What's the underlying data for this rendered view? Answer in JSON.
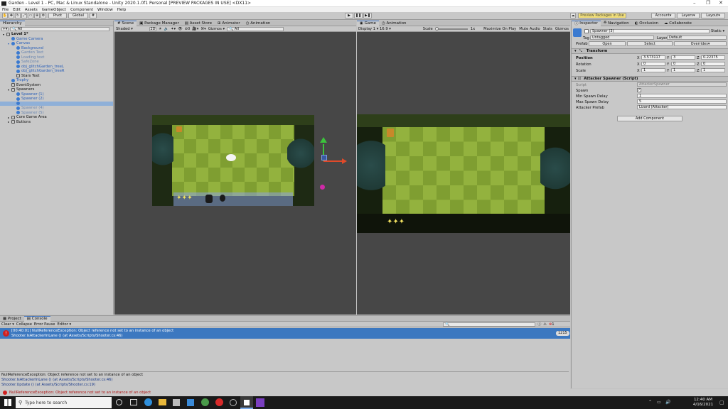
{
  "window": {
    "title": "Garden - Level 1 - PC, Mac & Linux Standalone - Unity 2020.1.0f1 Personal [PREVIEW PACKAGES IN USE] <DX11>"
  },
  "menu": [
    "File",
    "Edit",
    "Assets",
    "GameObject",
    "Component",
    "Window",
    "Help"
  ],
  "toolbar": {
    "pivot": "Pivot",
    "global": "Global",
    "preview_packages": "Preview Packages in Use",
    "account": "Account",
    "layers": "Layers",
    "layout": "Layout"
  },
  "hierarchy": {
    "tab": "Hierarchy",
    "search_placeholder": "All",
    "items": [
      {
        "label": "Level 1*",
        "indent": 0,
        "style": "bold"
      },
      {
        "label": "Game Camera",
        "indent": 1,
        "style": "blue"
      },
      {
        "label": "Canvas",
        "indent": 1,
        "style": "blue"
      },
      {
        "label": "Background",
        "indent": 2,
        "style": "blue"
      },
      {
        "label": "Garden Text",
        "indent": 2,
        "style": "grey"
      },
      {
        "label": "Loading text",
        "indent": 2,
        "style": "grey"
      },
      {
        "label": "SafeZone",
        "indent": 2,
        "style": "grey"
      },
      {
        "label": "obj_glitchGarden_treeL",
        "indent": 2,
        "style": "blue"
      },
      {
        "label": "obj_glitchGarden_treeR",
        "indent": 2,
        "style": "blue"
      },
      {
        "label": "Stars Text",
        "indent": 2,
        "style": "plain"
      },
      {
        "label": "Trophy",
        "indent": 1,
        "style": "blue"
      },
      {
        "label": "EventSystem",
        "indent": 1,
        "style": "plain"
      },
      {
        "label": "Spawners",
        "indent": 1,
        "style": "plain"
      },
      {
        "label": "Spawner (1)",
        "indent": 2,
        "style": "blue"
      },
      {
        "label": "Spawner (2)",
        "indent": 2,
        "style": "blue"
      },
      {
        "label": "",
        "indent": 2,
        "style": "sel"
      },
      {
        "label": "Spawner (4)",
        "indent": 2,
        "style": "grey"
      },
      {
        "label": "Spawner (5)",
        "indent": 2,
        "style": "grey"
      },
      {
        "label": "Core Game Area",
        "indent": 1,
        "style": "plain"
      },
      {
        "label": "Buttons",
        "indent": 1,
        "style": "plain"
      }
    ]
  },
  "scene": {
    "tabs": [
      "Scene",
      "Package Manager",
      "Asset Store",
      "Animator",
      "Animation"
    ],
    "shading": "Shaded",
    "mode_2d": "2D",
    "gizmos": "Gizmos",
    "search_placeholder": "All",
    "hidden_count": "0"
  },
  "game": {
    "tabs": [
      "Game",
      "Animation"
    ],
    "display": "Display 1",
    "aspect": "16:9",
    "scale_label": "Scale",
    "scale_value": "1x",
    "maximize": "Maximize On Play",
    "mute": "Mute Audio",
    "stats": "Stats",
    "gizmos": "Gizmos"
  },
  "inspector": {
    "tabs": [
      "Inspector",
      "Navigation",
      "Occlusion",
      "Collaborate"
    ],
    "object_name": "Spawner (3)",
    "static": "Static",
    "tag_label": "Tag",
    "tag": "Untagged",
    "layer_label": "Layer",
    "layer": "Default",
    "prefab_label": "Prefab",
    "prefab_open": "Open",
    "prefab_select": "Select",
    "prefab_overrides": "Overrides",
    "transform": {
      "title": "Transform",
      "position_label": "Position",
      "rotation_label": "Rotation",
      "scale_label": "Scale",
      "position": [
        "3.573117",
        "3",
        "0.22375"
      ],
      "rotation": [
        "0",
        "0",
        "0"
      ],
      "scale": [
        "1",
        "1",
        "1"
      ]
    },
    "script_component": {
      "title": "Attacker Spawner (Script)",
      "script_label": "Script",
      "script_value": "AttackerSpawner",
      "spawn_label": "Spawn",
      "min_label": "Min Spawn Delay",
      "min_value": "1",
      "max_label": "Max Spawn Delay",
      "max_value": "5",
      "prefab_label": "Attacker Prefab",
      "prefab_value": "Lizard (Attacker)"
    },
    "add_component": "Add Component"
  },
  "console": {
    "tabs": [
      "Project",
      "Console"
    ],
    "buttons": [
      "Clear",
      "Collapse",
      "Error Pause",
      "Editor"
    ],
    "error_count": "1",
    "entry_line1": "[00:40:01] NullReferenceException: Object reference not set to an instance of an object",
    "entry_line2": "Shooter.IsAttackerInLane () (at Assets/Scripts/Shooter.cs:46)",
    "entry_badge": "1215",
    "detail1": "NullReferenceException: Object reference not set to an instance of an object",
    "detail2": "Shooter.IsAttackerInLane () (at Assets/Scripts/Shooter.cs:46)",
    "detail3": "Shooter.Update () (at Assets/Scripts/Shooter.cs:19)"
  },
  "status": "NullReferenceException: Object reference not set to an instance of an object",
  "taskbar": {
    "search_placeholder": "Type here to search",
    "time": "12:40 AM",
    "date": "4/16/2021"
  },
  "colors": {
    "accent": "#3a72c4",
    "error": "#d02020",
    "selected_row": "#3c78c0",
    "grass_light": "#8fae3a",
    "grass_dark": "#7a9a2e"
  }
}
